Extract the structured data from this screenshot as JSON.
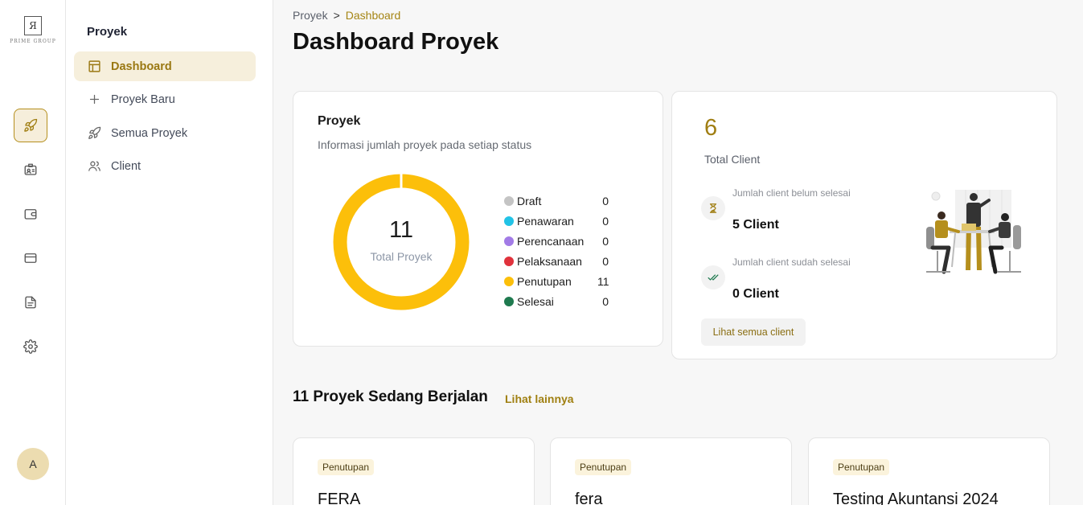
{
  "logo": {
    "mark": "Я",
    "text": "PRIME GROUP"
  },
  "rail": [
    {
      "icon": "rocket-icon",
      "active": true
    },
    {
      "icon": "id-card-icon"
    },
    {
      "icon": "wallet-icon"
    },
    {
      "icon": "card-icon"
    },
    {
      "icon": "document-icon"
    },
    {
      "icon": "gear-icon"
    }
  ],
  "user": {
    "initial": "A"
  },
  "subnav": {
    "title": "Proyek",
    "items": [
      {
        "label": "Dashboard",
        "icon": "layout-icon",
        "active": true
      },
      {
        "label": "Proyek Baru",
        "icon": "plus-icon"
      },
      {
        "label": "Semua Proyek",
        "icon": "rocket-icon"
      },
      {
        "label": "Client",
        "icon": "users-icon"
      }
    ]
  },
  "breadcrumb": {
    "parent": "Proyek",
    "separator": ">",
    "current": "Dashboard"
  },
  "page_title": "Dashboard Proyek",
  "proyek_card": {
    "title": "Proyek",
    "subtitle": "Informasi jumlah proyek pada setiap status",
    "total": "11",
    "total_label": "Total Proyek",
    "statuses": [
      {
        "label": "Draft",
        "value": "0",
        "color": "#c4c4c4"
      },
      {
        "label": "Penawaran",
        "value": "0",
        "color": "#22c3e6"
      },
      {
        "label": "Perencanaan",
        "value": "0",
        "color": "#a27be6"
      },
      {
        "label": "Pelaksanaan",
        "value": "0",
        "color": "#e0323c"
      },
      {
        "label": "Penutupan",
        "value": "11",
        "color": "#fcbf0a"
      },
      {
        "label": "Selesai",
        "value": "0",
        "color": "#1f7a4f"
      }
    ]
  },
  "client_card": {
    "total": "6",
    "total_label": "Total Client",
    "pending_label": "Jumlah client belum selesai",
    "pending_value": "5",
    "pending_unit": "Client",
    "done_label": "Jumlah client sudah selesai",
    "done_value": "0",
    "done_unit": "Client",
    "button": "Lihat semua client"
  },
  "running": {
    "title": "11 Proyek Sedang Berjalan",
    "link": "Lihat lainnya",
    "projects": [
      {
        "status": "Penutupan",
        "name": "FERA"
      },
      {
        "status": "Penutupan",
        "name": "fera"
      },
      {
        "status": "Penutupan",
        "name": "Testing Akuntansi 2024"
      }
    ]
  },
  "colors": {
    "accent": "#a58514",
    "accent_bg": "#f6efdc",
    "donut": "#fcbf0a"
  }
}
